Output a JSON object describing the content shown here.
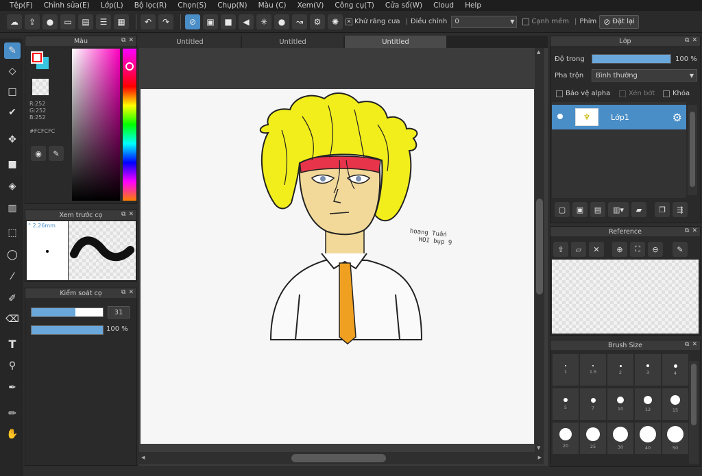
{
  "menu": [
    "Tệp(F)",
    "Chỉnh sửa(E)",
    "Lớp(L)",
    "Bộ lọc(R)",
    "Chọn(S)",
    "Chụp(N)",
    "Màu (C)",
    "Xem(V)",
    "Công cụ(T)",
    "Cửa sổ(W)",
    "Cloud",
    "Help"
  ],
  "toolbar": {
    "antialias_label": "Khử răng cưa",
    "adjust_label": "Điều chỉnh",
    "adjust_value": "0",
    "edge_label": "Cạnh mềm",
    "key_label": "Phím",
    "reset_label": "Đặt lại"
  },
  "color_panel": {
    "title": "Màu",
    "r": "R:252",
    "g": "G:252",
    "b": "B:252",
    "hex": "#FCFCFC"
  },
  "brush_preview": {
    "title": "Xem trước cọ",
    "size": "2.26mm"
  },
  "brush_control": {
    "title": "Kiểm soát cọ",
    "size_value": "31",
    "size_fraction": 0.62,
    "opacity_value": "100 %",
    "opacity_fraction": 1.0
  },
  "tabs": [
    "Untitled",
    "Untitled",
    "Untitled"
  ],
  "layer_panel": {
    "title": "Lớp",
    "opacity_label": "Độ trong",
    "opacity_value": "100 %",
    "blend_label": "Pha trộn",
    "blend_value": "Bình thường",
    "protect_alpha": "Bảo vệ alpha",
    "clipping": "Xén bớt",
    "lock": "Khóa",
    "layer_name": "Lớp1"
  },
  "reference_panel": {
    "title": "Reference"
  },
  "brush_size_panel": {
    "title": "Brush Size",
    "sizes": [
      "1",
      "1.5",
      "2",
      "3",
      "4",
      "5",
      "7",
      "10",
      "12",
      "15",
      "20",
      "25",
      "30",
      "40",
      "50"
    ]
  },
  "canvas": {
    "signature_line1": "hoang Tuấn",
    "signature_line2": "HOI bụp 9"
  },
  "colors": {
    "accent": "#4a8ec8",
    "hair": "#f2ee1c",
    "headband": "#e8344a",
    "skin": "#f2d99a",
    "tie": "#f0a020"
  }
}
